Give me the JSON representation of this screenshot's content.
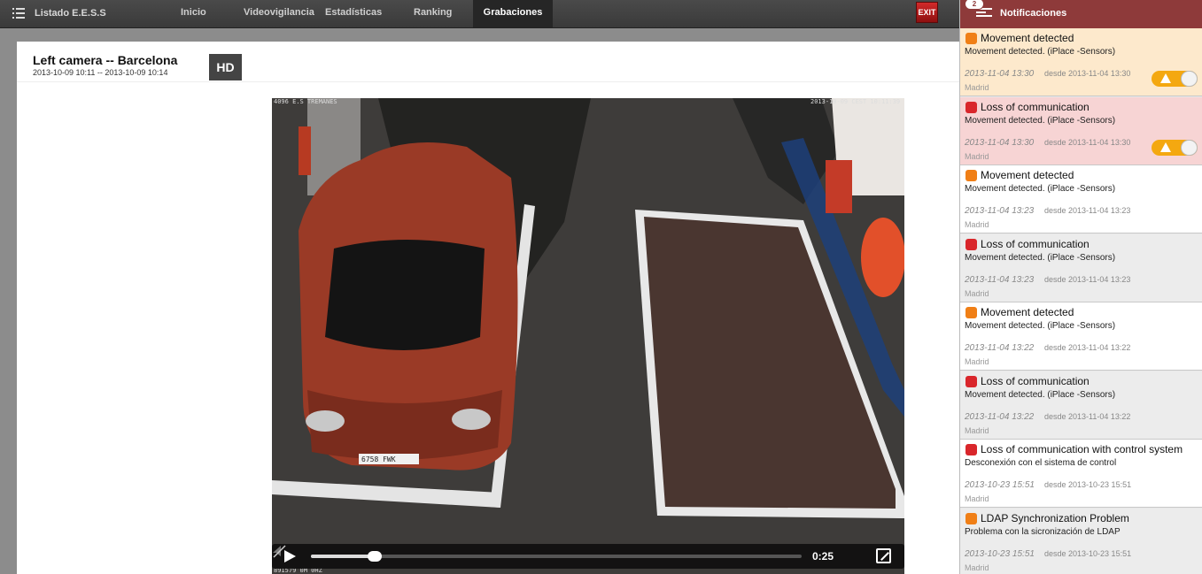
{
  "nav": {
    "brand": "Listado E.E.S.S",
    "items": [
      "Inicio",
      "Videovigilancia",
      "Estadísticas",
      "Ranking",
      "Grabaciones"
    ],
    "active": "Grabaciones",
    "exit_label": "EXIT"
  },
  "camera": {
    "title": "Left camera -- Barcelona",
    "range": "2013-10-09 10:11 -- 2013-10-09 10:14",
    "hd_label": "HD"
  },
  "video": {
    "time": "0:25",
    "progress_percent": 13,
    "plate": "6758 FWK",
    "osd_top_left": "4096 E.S TREMANES",
    "osd_top_right": "2013-10-09 CEST 10:11:39",
    "osd_bottom_left": "891579 0M 0HZ"
  },
  "notifications": {
    "title": "Notificaciones",
    "count": "2",
    "items": [
      {
        "title": "Movement detected",
        "desc": "Movement detected. (iPlace -Sensors)",
        "date": "2013-11-04 13:30",
        "since": "desde 2013-11-04 13:30",
        "location": "Madrid",
        "severity_color": "#f07f16",
        "bg": "#fde9cc",
        "toggle": true
      },
      {
        "title": "Loss of communication",
        "desc": "Movement detected. (iPlace -Sensors)",
        "date": "2013-11-04 13:30",
        "since": "desde 2013-11-04 13:30",
        "location": "Madrid",
        "severity_color": "#d9262b",
        "bg": "#f7d4d4",
        "toggle": true
      },
      {
        "title": "Movement detected",
        "desc": "Movement detected. (iPlace -Sensors)",
        "date": "2013-11-04 13:23",
        "since": "desde 2013-11-04 13:23",
        "location": "Madrid",
        "severity_color": "#f07f16",
        "bg": "#ffffff",
        "toggle": false
      },
      {
        "title": "Loss of communication",
        "desc": "Movement detected. (iPlace -Sensors)",
        "date": "2013-11-04 13:23",
        "since": "desde 2013-11-04 13:23",
        "location": "Madrid",
        "severity_color": "#d9262b",
        "bg": "#ececec",
        "toggle": false
      },
      {
        "title": "Movement detected",
        "desc": "Movement detected. (iPlace -Sensors)",
        "date": "2013-11-04 13:22",
        "since": "desde 2013-11-04 13:22",
        "location": "Madrid",
        "severity_color": "#f07f16",
        "bg": "#ffffff",
        "toggle": false
      },
      {
        "title": "Loss of communication",
        "desc": "Movement detected. (iPlace -Sensors)",
        "date": "2013-11-04 13:22",
        "since": "desde 2013-11-04 13:22",
        "location": "Madrid",
        "severity_color": "#d9262b",
        "bg": "#ececec",
        "toggle": false
      },
      {
        "title": "Loss of communication with control system",
        "desc": "Desconexión con el sistema de control",
        "date": "2013-10-23 15:51",
        "since": "desde 2013-10-23 15:51",
        "location": "Madrid",
        "severity_color": "#d9262b",
        "bg": "#ffffff",
        "toggle": false
      },
      {
        "title": "LDAP Synchronization Problem",
        "desc": "Problema con la sicronización de LDAP",
        "date": "2013-10-23 15:51",
        "since": "desde 2013-10-23 15:51",
        "location": "Madrid",
        "severity_color": "#f07f16",
        "bg": "#ececec",
        "toggle": false
      }
    ]
  }
}
